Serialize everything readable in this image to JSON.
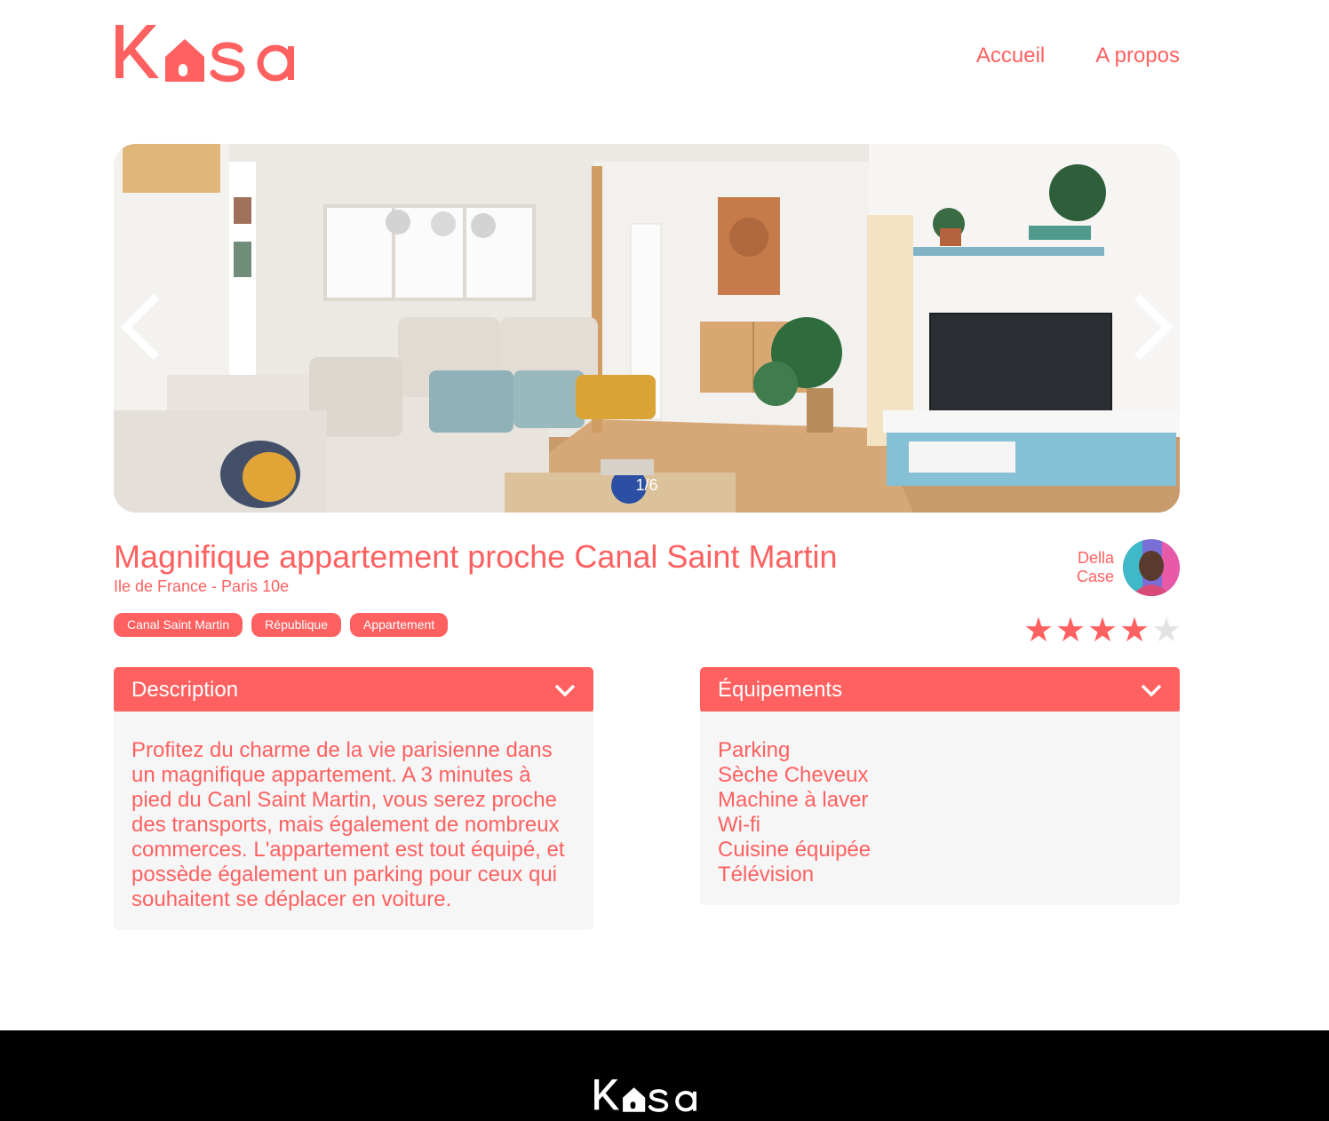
{
  "header": {
    "logo_text": "Kasa",
    "nav": [
      {
        "label": "Accueil"
      },
      {
        "label": "A propos"
      }
    ]
  },
  "carousel": {
    "counter": "1/6",
    "current_index": 1,
    "total": 6
  },
  "listing": {
    "title": "Magnifique appartement proche Canal Saint Martin",
    "location": "Ile de France - Paris 10e",
    "tags": [
      "Canal Saint Martin",
      "République",
      "Appartement"
    ],
    "host": {
      "first_name": "Della",
      "last_name": "Case"
    },
    "rating": 4,
    "rating_max": 5
  },
  "description": {
    "label": "Description",
    "text": "Profitez du charme de la vie parisienne dans un magnifique appartement. A 3 minutes à pied du Canl Saint Martin, vous serez proche des transports, mais également de nombreux commerces. L'appartement est tout équipé, et possède également un parking pour ceux qui souhaitent se déplacer en voiture."
  },
  "equipments": {
    "label": "Équipements",
    "items": [
      "Parking",
      "Sèche Cheveux",
      "Machine à laver",
      "Wi-fi",
      "Cuisine équipée",
      "Télévision"
    ]
  },
  "footer": {
    "logo_text": "Kasa"
  },
  "colors": {
    "accent": "#FF6060",
    "panel_bg": "#F6F6F6",
    "star_off": "#E3E3E3",
    "footer_bg": "#000000"
  }
}
